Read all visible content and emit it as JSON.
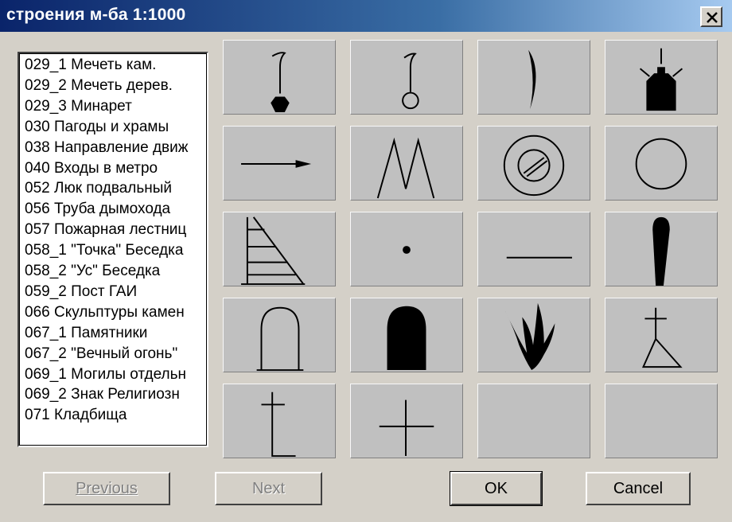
{
  "window": {
    "title": "строения м-ба 1:1000"
  },
  "list": {
    "items": [
      "029_1 Мечеть кам.",
      "029_2 Мечеть дерев.",
      "029_3 Минарет",
      "030 Пагоды и храмы",
      "038 Направление движ",
      "040 Входы в метро",
      "052 Люк подвальный",
      "056 Труба дымохода",
      "057 Пожарная лестниц",
      "058_1 \"Точка\" Беседка",
      "058_2 \"Ус\" Беседка",
      "059_2 Пост ГАИ",
      "066 Скульптуры камен",
      "067_1 Памятники",
      "067_2 \"Вечный огонь\"",
      "069_1 Могилы отдельн",
      "069_2 Знак Религиозн",
      "071 Кладбища"
    ]
  },
  "symbols": [
    "mosque-stone-icon",
    "mosque-wood-icon",
    "minaret-icon",
    "pagoda-temple-icon",
    "direction-arrow-icon",
    "metro-entrance-icon",
    "basement-hatch-icon",
    "chimney-icon",
    "fire-ladder-icon",
    "gazebo-dot-icon",
    "gazebo-line-icon",
    "traffic-police-post-icon",
    "stone-sculpture-icon",
    "monument-icon",
    "eternal-flame-icon",
    "single-grave-icon",
    "religious-sign-icon",
    "cemetery-cross-icon",
    "empty-slot",
    "empty-slot"
  ],
  "buttons": {
    "previous": "Previous",
    "next": "Next",
    "ok": "OK",
    "cancel": "Cancel"
  }
}
